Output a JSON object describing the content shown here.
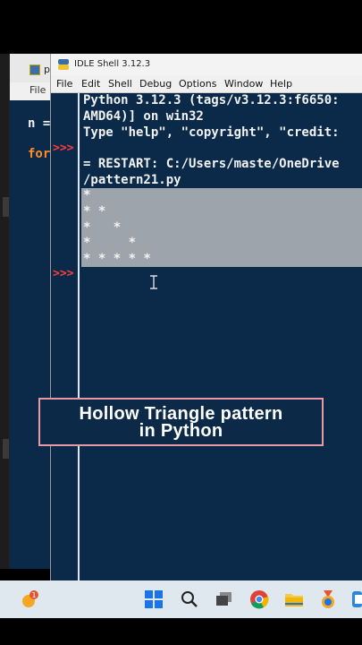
{
  "background_window": {
    "title": "p",
    "menu_label": "File",
    "code_lines": [
      {
        "text": "n =",
        "color": "#f2f2f2"
      },
      {
        "text": "for",
        "color": "#ff8c2a"
      }
    ]
  },
  "idle": {
    "title": "IDLE Shell 3.12.3",
    "menu": [
      "File",
      "Edit",
      "Shell",
      "Debug",
      "Options",
      "Window",
      "Help"
    ],
    "prompt_symbol": ">>>",
    "output_lines": [
      "Python 3.12.3 (tags/v3.12.3:f6650:",
      "AMD64)] on win32",
      "Type \"help\", \"copyright\", \"credit:",
      "",
      "= RESTART: C:/Users/maste/OneDrive",
      "/pattern21.py",
      "*",
      "* *",
      "*   *",
      "*     *",
      "* * * * *"
    ]
  },
  "banner": {
    "line1": "Hollow Triangle pattern",
    "line2": "in Python",
    "border_color": "#e79aa6"
  },
  "taskbar": {
    "badge_count": "1",
    "icons": [
      "weather-icon",
      "windows-start-icon",
      "search-icon",
      "task-view-icon",
      "chrome-icon",
      "file-explorer-icon",
      "medal-icon",
      "app-icon"
    ]
  }
}
